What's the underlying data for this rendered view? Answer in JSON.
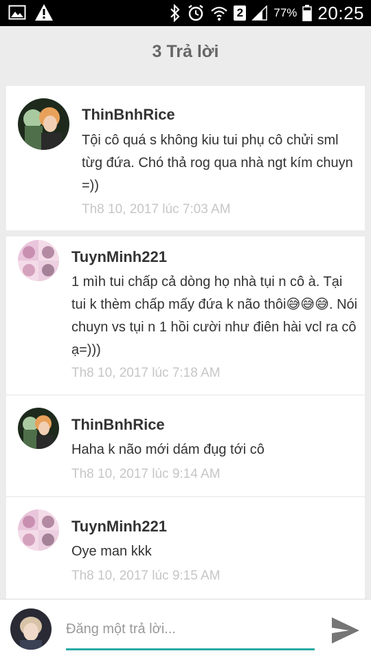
{
  "status_bar": {
    "sim_label": "2",
    "battery": "77%",
    "time": "20:25",
    "icons": [
      "image-icon",
      "warning-icon",
      "bluetooth-icon",
      "alarm-icon",
      "wifi-icon",
      "signal-icon",
      "battery-icon"
    ]
  },
  "header": {
    "title": "3 Trả lời"
  },
  "thread": {
    "parent": {
      "username": "ThinBnhRice",
      "text": "Tội cô quá s không kiu tui phụ cô chửi sml từg đứa. Chó thả rog qua nhà ngt kím chuyn =))",
      "time": "Th8 10, 2017 lúc 7:03 AM"
    },
    "replies": [
      {
        "username": "TuynMinh221",
        "text": "1 mìh tui chấp cả dòng họ nhà tụi n cô à. Tại tui k thèm chấp mấy đứa k não thôi😅😅😅. Nói chuyn vs tụi n 1 hồi cười như điên hài vcl ra cô ạ=)))",
        "time": "Th8 10, 2017 lúc 7:18 AM"
      },
      {
        "username": "ThinBnhRice",
        "text": "Haha k não mới dám đụg tới cô",
        "time": "Th8 10, 2017 lúc 9:14 AM"
      },
      {
        "username": "TuynMinh221",
        "text": "Oye man kkk",
        "time": "Th8 10, 2017 lúc 9:15 AM"
      }
    ]
  },
  "compose": {
    "placeholder": "Đăng một trả lời...",
    "send_icon": "send-icon"
  },
  "colors": {
    "status_bar": "#000000",
    "background": "#ececec",
    "card": "#ffffff",
    "accent": "#26aaa5",
    "timestamp": "#c6c6c6"
  }
}
